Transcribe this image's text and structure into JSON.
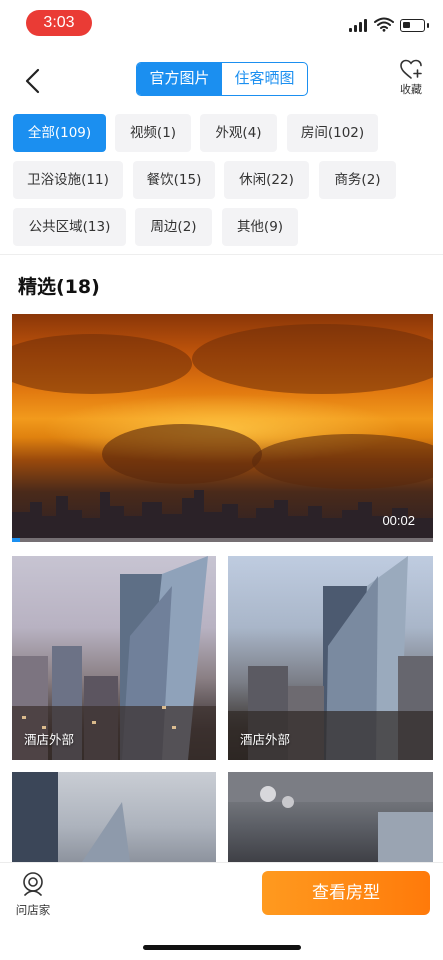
{
  "status_bar": {
    "time": "3:03"
  },
  "nav": {
    "tabs": [
      {
        "label": "官方图片",
        "active": true
      },
      {
        "label": "住客晒图",
        "active": false
      }
    ],
    "favorite_label": "收藏"
  },
  "categories": [
    {
      "label": "全部(109)",
      "active": true
    },
    {
      "label": "视频(1)"
    },
    {
      "label": "外观(4)"
    },
    {
      "label": "房间(102)"
    },
    {
      "label": "卫浴设施(11)"
    },
    {
      "label": "餐饮(15)"
    },
    {
      "label": "休闲(22)"
    },
    {
      "label": "商务(2)"
    },
    {
      "label": "公共区域(13)"
    },
    {
      "label": "周边(2)"
    },
    {
      "label": "其他(9)"
    }
  ],
  "section": {
    "title": "精选(18)"
  },
  "video": {
    "duration": "00:02",
    "progress": 0.02
  },
  "photos": [
    {
      "caption": "酒店外部"
    },
    {
      "caption": "酒店外部"
    },
    {
      "caption": ""
    },
    {
      "caption": ""
    }
  ],
  "bottom_bar": {
    "ask_label": "问店家",
    "cta_label": "查看房型"
  },
  "colors": {
    "accent": "#1b8ff0",
    "cta": "#ff8a14",
    "time_pill": "#ea3b35"
  },
  "icons": [
    "back-arrow-icon",
    "heart-plus-icon",
    "signal-icon",
    "wifi-icon",
    "battery-icon",
    "chat-person-icon"
  ]
}
